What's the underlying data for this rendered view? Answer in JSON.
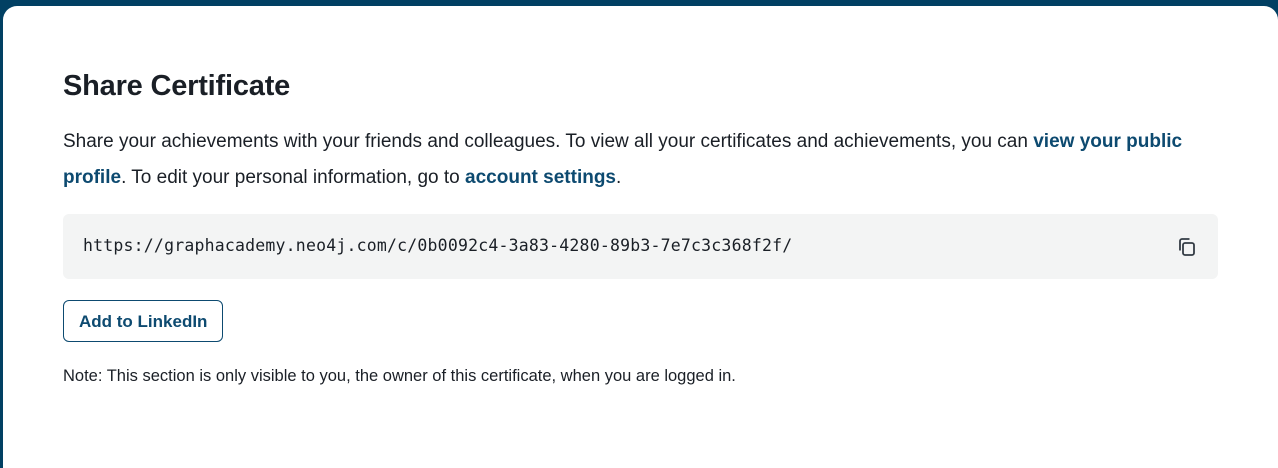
{
  "card": {
    "title": "Share Certificate",
    "description": {
      "part1": "Share your achievements with your friends and colleagues. To view all your certificates and achievements, you can ",
      "link_profile": "view your public profile",
      "part2": ". To edit your personal information, go to ",
      "link_settings": "account settings",
      "part3": "."
    },
    "certificate_url": "https://graphacademy.neo4j.com/c/0b0092c4-3a83-4280-89b3-7e7c3c368f2f/",
    "copy_icon": "copy-icon",
    "linkedin_button_label": "Add to LinkedIn",
    "note": "Note: This section is only visible to you, the owner of this certificate, when you are logged in."
  },
  "colors": {
    "page_background": "#014063",
    "card_background": "#ffffff",
    "link": "#0d4a70",
    "text": "#1a1f26",
    "url_box_background": "#f3f4f4"
  }
}
